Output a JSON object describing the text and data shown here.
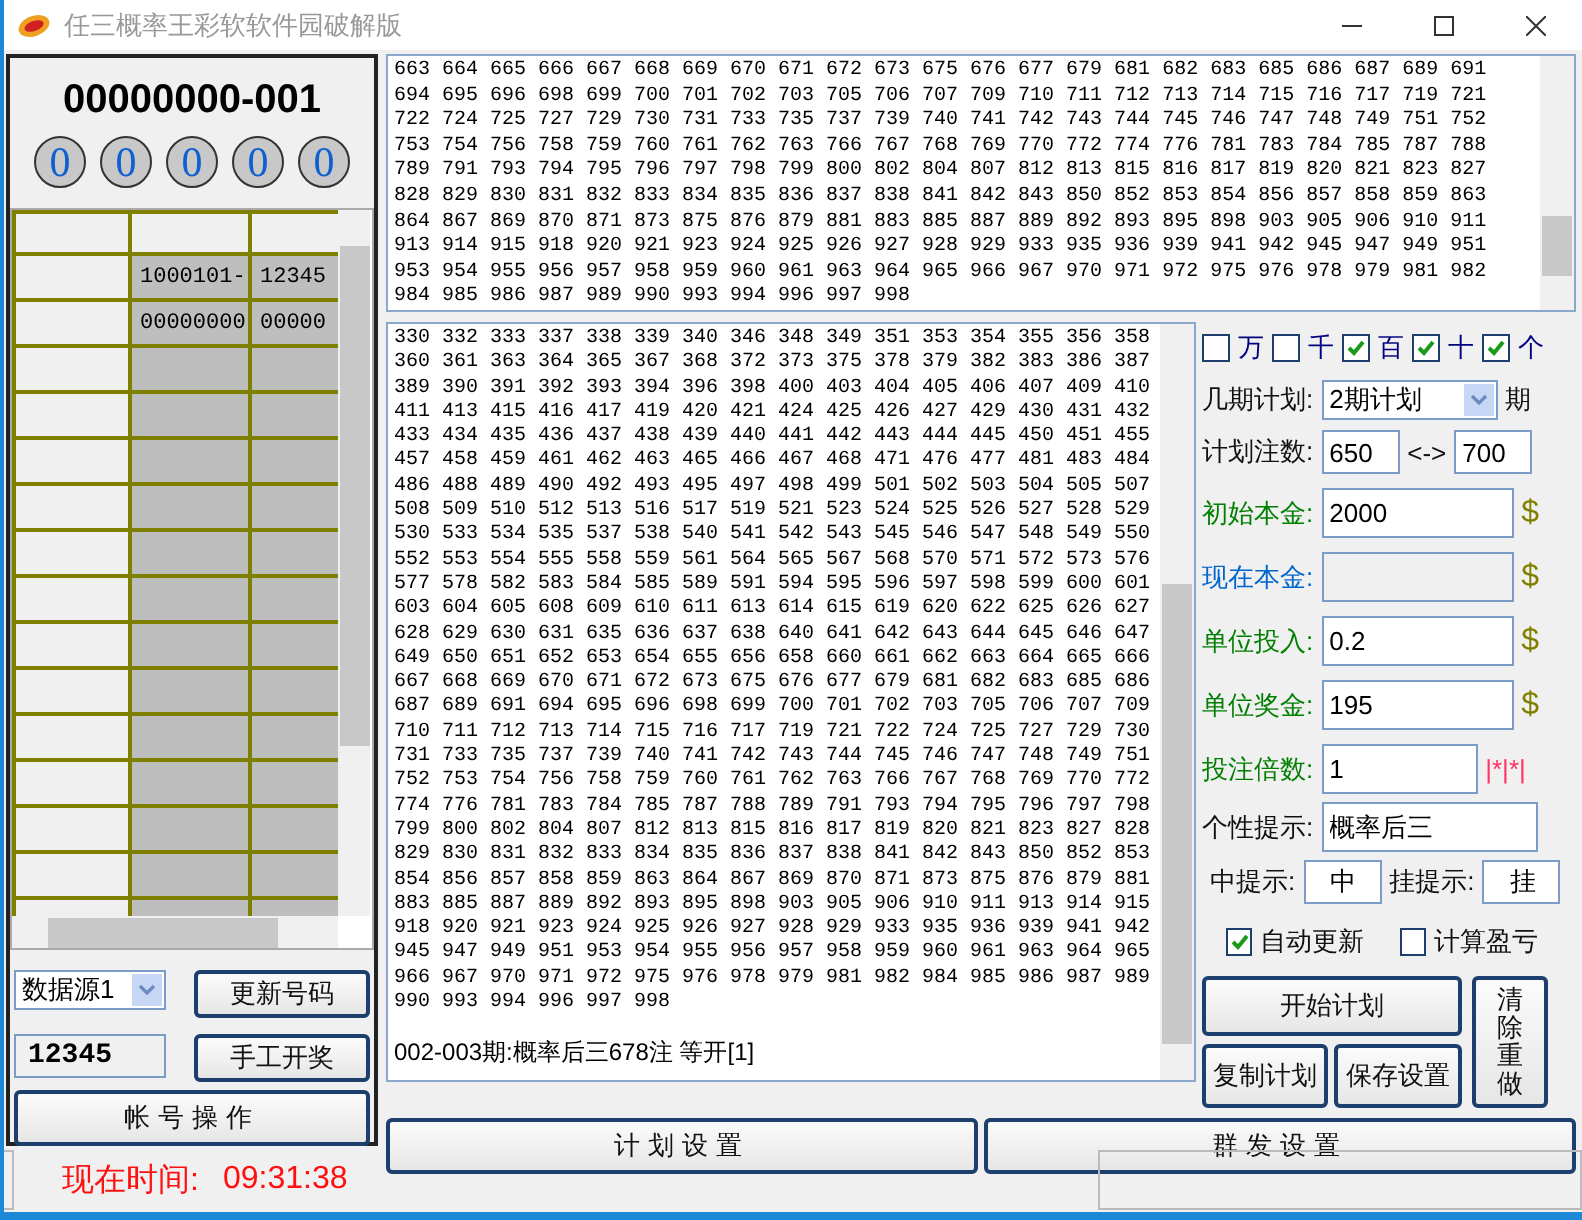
{
  "window": {
    "title": "任三概率王彩软软件园破解版"
  },
  "left": {
    "serial": "00000000-001",
    "balls": [
      "0",
      "0",
      "0",
      "0",
      "0"
    ],
    "grid": {
      "rows": [
        {
          "cells": [
            "1000101-",
            "12345"
          ]
        },
        {
          "cells": [
            "00000000",
            "00000"
          ]
        }
      ]
    },
    "source": "数据源1",
    "update_button": "更新号码",
    "number_value": "12345",
    "draw_button": "手工开奖",
    "account_button": "帐号操作"
  },
  "top_numbers": [
    "663 664 665 666 667 668 669 670 671 672 673 675 676 677 679 681 682 683 685 686 687 689 691",
    "694 695 696 698 699 700 701 702 703 705 706 707 709 710 711 712 713 714 715 716 717 719 721",
    "722 724 725 727 729 730 731 733 735 737 739 740 741 742 743 744 745 746 747 748 749 751 752",
    "753 754 756 758 759 760 761 762 763 766 767 768 769 770 772 774 776 781 783 784 785 787 788",
    "789 791 793 794 795 796 797 798 799 800 802 804 807 812 813 815 816 817 819 820 821 823 827",
    "828 829 830 831 832 833 834 835 836 837 838 841 842 843 850 852 853 854 856 857 858 859 863",
    "864 867 869 870 871 873 875 876 879 881 883 885 887 889 892 893 895 898 903 905 906 910 911",
    "913 914 915 918 920 921 923 924 925 926 927 928 929 933 935 936 939 941 942 945 947 949 951",
    "953 954 955 956 957 958 959 960 961 963 964 965 966 967 970 971 972 975 976 978 979 981 982",
    "984 985 986 987 989 990 993 994 996 997 998"
  ],
  "plan_numbers": [
    "330 332 333 337 338 339 340 346 348 349 351 353 354 355 356 358",
    "360 361 363 364 365 367 368 372 373 375 378 379 382 383 386 387",
    "389 390 391 392 393 394 396 398 400 403 404 405 406 407 409 410",
    "411 413 415 416 417 419 420 421 424 425 426 427 429 430 431 432",
    "433 434 435 436 437 438 439 440 441 442 443 444 445 450 451 455",
    "457 458 459 461 462 463 465 466 467 468 471 476 477 481 483 484",
    "486 488 489 490 492 493 495 497 498 499 501 502 503 504 505 507",
    "508 509 510 512 513 516 517 519 521 523 524 525 526 527 528 529",
    "530 533 534 535 537 538 540 541 542 543 545 546 547 548 549 550",
    "552 553 554 555 558 559 561 564 565 567 568 570 571 572 573 576",
    "577 578 582 583 584 585 589 591 594 595 596 597 598 599 600 601",
    "603 604 605 608 609 610 611 613 614 615 619 620 622 625 626 627",
    "628 629 630 631 635 636 637 638 640 641 642 643 644 645 646 647",
    "649 650 651 652 653 654 655 656 658 660 661 662 663 664 665 666",
    "667 668 669 670 671 672 673 675 676 677 679 681 682 683 685 686",
    "687 689 691 694 695 696 698 699 700 701 702 703 705 706 707 709",
    "710 711 712 713 714 715 716 717 719 721 722 724 725 727 729 730",
    "731 733 735 737 739 740 741 742 743 744 745 746 747 748 749 751",
    "752 753 754 756 758 759 760 761 762 763 766 767 768 769 770 772",
    "774 776 781 783 784 785 787 788 789 791 793 794 795 796 797 798",
    "799 800 802 804 807 812 813 815 816 817 819 820 821 823 827 828",
    "829 830 831 832 833 834 835 836 837 838 841 842 843 850 852 853",
    "854 856 857 858 859 863 864 867 869 870 871 873 875 876 879 881",
    "883 885 887 889 892 893 895 898 903 905 906 910 911 913 914 915",
    "918 920 921 923 924 925 926 927 928 929 933 935 936 939 941 942",
    "945 947 949 951 953 954 955 956 957 958 959 960 961 963 964 965",
    "966 967 970 971 972 975 976 978 979 981 982 984 985 986 987 989",
    "990 993 994 996 997 998"
  ],
  "plan_result": "002-003期:概率后三678注 等开[1]",
  "digits": [
    {
      "label": "万",
      "checked": false
    },
    {
      "label": "千",
      "checked": false
    },
    {
      "label": "百",
      "checked": true
    },
    {
      "label": "十",
      "checked": true
    },
    {
      "label": "个",
      "checked": true
    }
  ],
  "period": {
    "label": "几期计划:",
    "value": "2期计划",
    "suffix": "期"
  },
  "bet_count": {
    "label": "计划注数:",
    "from": "650",
    "between": "<->",
    "to": "700"
  },
  "money_fields": [
    {
      "label": "初始本金:",
      "value": "2000",
      "color": "#008000",
      "unit": "$"
    },
    {
      "label": "现在本金:",
      "color": "#0066cc",
      "unit": "$"
    },
    {
      "label": "单位投入:",
      "value": "0.2",
      "color": "#008000",
      "unit": "$"
    },
    {
      "label": "单位奖金:",
      "value": "195",
      "color": "#008000",
      "unit": "$"
    },
    {
      "label": "投注倍数:",
      "value": "1",
      "color": "#008000",
      "unit": "|*|*|"
    }
  ],
  "hint": {
    "label": "个性提示:",
    "value": "概率后三"
  },
  "win_hint": {
    "label": "中提示:",
    "value": "中"
  },
  "lose_hint": {
    "label": "挂提示:",
    "value": "挂"
  },
  "options": [
    {
      "label": "自动更新",
      "checked": true
    },
    {
      "label": "计算盈亏",
      "checked": false
    }
  ],
  "start_button": "开始计划",
  "copy_button": "复制计划",
  "save_button": "保存设置",
  "reset_button": "清除重做",
  "bottom_tabs": [
    "计划设置",
    "群发设置"
  ],
  "status": {
    "time_label": "现在时间:",
    "time": "09:31:38"
  }
}
